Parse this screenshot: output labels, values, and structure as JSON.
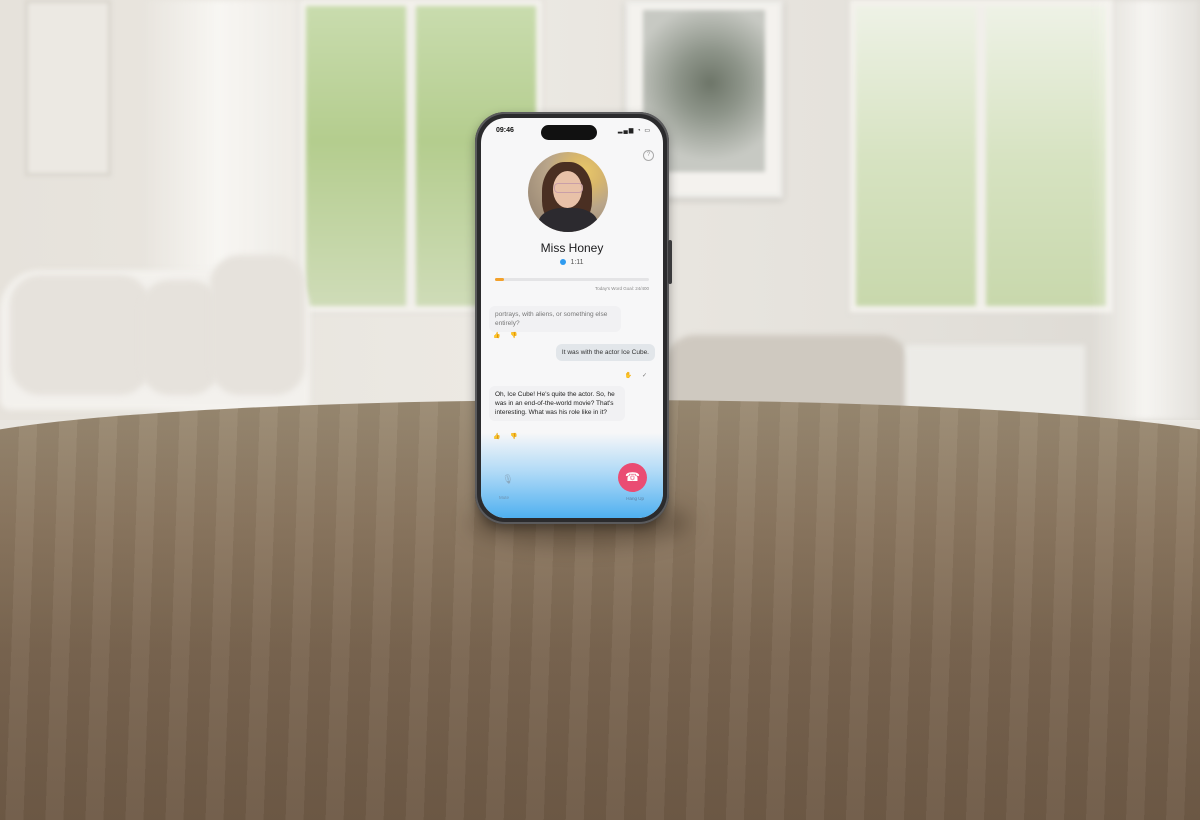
{
  "status": {
    "time": "09:46",
    "icons": "▂▄▆ ◔ ▭"
  },
  "caller": {
    "name": "Miss Honey",
    "duration": "1:11"
  },
  "word_goal": {
    "label": "Today's Word Goal: 24/400",
    "progress": 0.06
  },
  "messages": [
    {
      "role": "ai",
      "text": "portrays, with aliens, or something else entirely?"
    },
    {
      "role": "user",
      "text": "It was with the actor Ice Cube."
    },
    {
      "role": "ai",
      "text": "Oh, Ice Cube! He's quite the actor. So, he was in an end-of-the-world movie? That's interesting. What was his role like in it?"
    }
  ],
  "reactions": {
    "ai": "👍 👎",
    "user": "✋ ✓"
  },
  "controls": {
    "mic_label": "Mute",
    "hangup_label": "Hang Up"
  },
  "colors": {
    "hangup": "#ea4c73",
    "accent": "#4fb0f0",
    "goal": "#f3a12b"
  }
}
